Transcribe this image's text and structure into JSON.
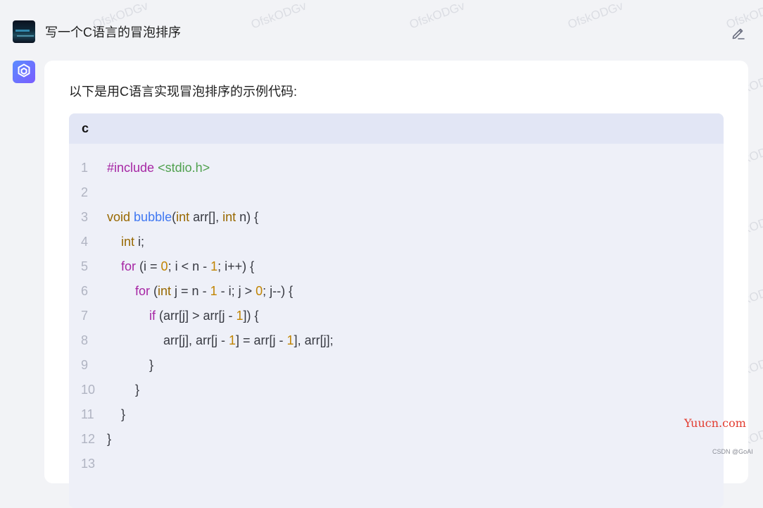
{
  "user": {
    "question": "写一个C语言的冒泡排序"
  },
  "answer": {
    "intro": "以下是用C语言实现冒泡排序的示例代码:",
    "code": {
      "language": "c",
      "lines": [
        {
          "num": "1",
          "tokens": [
            {
              "t": "#include",
              "c": "kw"
            },
            {
              "t": " "
            },
            {
              "t": "<stdio.h>",
              "c": "str"
            }
          ]
        },
        {
          "num": "2",
          "tokens": []
        },
        {
          "num": "3",
          "tokens": [
            {
              "t": "void",
              "c": "ty"
            },
            {
              "t": " "
            },
            {
              "t": "bubble",
              "c": "fn"
            },
            {
              "t": "("
            },
            {
              "t": "int",
              "c": "ty"
            },
            {
              "t": " arr[], "
            },
            {
              "t": "int",
              "c": "ty"
            },
            {
              "t": " n) {"
            }
          ]
        },
        {
          "num": "4",
          "tokens": [
            {
              "t": "    "
            },
            {
              "t": "int",
              "c": "ty"
            },
            {
              "t": " i;"
            }
          ]
        },
        {
          "num": "5",
          "tokens": [
            {
              "t": "    "
            },
            {
              "t": "for",
              "c": "kw"
            },
            {
              "t": " (i = "
            },
            {
              "t": "0",
              "c": "num"
            },
            {
              "t": "; i < n - "
            },
            {
              "t": "1",
              "c": "num"
            },
            {
              "t": "; i++) {"
            }
          ]
        },
        {
          "num": "6",
          "tokens": [
            {
              "t": "        "
            },
            {
              "t": "for",
              "c": "kw"
            },
            {
              "t": " ("
            },
            {
              "t": "int",
              "c": "ty"
            },
            {
              "t": " j = n - "
            },
            {
              "t": "1",
              "c": "num"
            },
            {
              "t": " - i; j > "
            },
            {
              "t": "0",
              "c": "num"
            },
            {
              "t": "; j--) {"
            }
          ]
        },
        {
          "num": "7",
          "tokens": [
            {
              "t": "            "
            },
            {
              "t": "if",
              "c": "kw"
            },
            {
              "t": " (arr[j] > arr[j - "
            },
            {
              "t": "1",
              "c": "num"
            },
            {
              "t": "]) {"
            }
          ]
        },
        {
          "num": "8",
          "tokens": [
            {
              "t": "                arr[j], arr[j - "
            },
            {
              "t": "1",
              "c": "num"
            },
            {
              "t": "] = arr[j - "
            },
            {
              "t": "1",
              "c": "num"
            },
            {
              "t": "], arr[j];"
            }
          ]
        },
        {
          "num": "9",
          "tokens": [
            {
              "t": "            }"
            }
          ]
        },
        {
          "num": "10",
          "tokens": [
            {
              "t": "        }"
            }
          ]
        },
        {
          "num": "11",
          "tokens": [
            {
              "t": "    }"
            }
          ]
        },
        {
          "num": "12",
          "tokens": [
            {
              "t": "}"
            }
          ]
        },
        {
          "num": "13",
          "tokens": []
        }
      ]
    }
  },
  "watermark": "OfskODGv",
  "brand": "Yuucn.com",
  "footer": "CSDN @GoAI",
  "icons": {
    "edit": "edit-pencil-icon",
    "bot": "cube-logo-icon"
  }
}
